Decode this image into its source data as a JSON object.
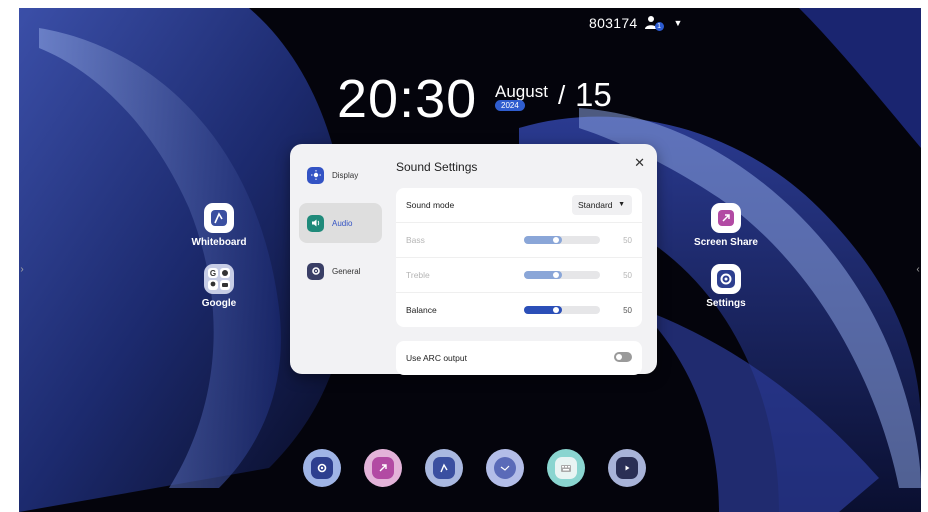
{
  "statusbar": {
    "user_id": "803174",
    "user_count": "1"
  },
  "clock": {
    "time": "20:30",
    "month": "August",
    "year": "2024",
    "separator": "/",
    "day": "15"
  },
  "desktop": {
    "left_apps": [
      {
        "label": "Whiteboard",
        "icon": "whiteboard-icon"
      },
      {
        "label": "Google",
        "icon": "google-apps-folder-icon"
      }
    ],
    "right_apps": [
      {
        "label": "Screen Share",
        "icon": "screen-share-icon"
      },
      {
        "label": "Settings",
        "icon": "settings-icon"
      }
    ]
  },
  "dialog": {
    "title": "Sound Settings",
    "nav": [
      {
        "label": "Display",
        "icon": "sun-icon",
        "color": "#3353c4"
      },
      {
        "label": "Audio",
        "icon": "speaker-icon",
        "color": "#1f8a7a"
      },
      {
        "label": "General",
        "icon": "gear-icon",
        "color": "#3a3f66"
      }
    ],
    "sound_mode": {
      "label": "Sound mode",
      "value": "Standard"
    },
    "bass": {
      "label": "Bass",
      "value": "50",
      "level": 0.5
    },
    "treble": {
      "label": "Treble",
      "value": "50",
      "level": 0.5
    },
    "balance": {
      "label": "Balance",
      "value": "50",
      "level": 0.5
    },
    "arc": {
      "label": "Use ARC output",
      "on": false
    }
  },
  "dock": [
    {
      "icon": "settings-icon",
      "ring": "#9fb4e6"
    },
    {
      "icon": "screen-share-icon",
      "ring": "#e3b3d9"
    },
    {
      "icon": "whiteboard-icon",
      "ring": "#a9b8e0"
    },
    {
      "icon": "clock-icon",
      "ring": "#b3bde8"
    },
    {
      "icon": "keyboard-icon",
      "ring": "#8ad5d0"
    },
    {
      "icon": "youtube-icon",
      "ring": "#a8b3d8"
    }
  ],
  "colors": {
    "accent": "#2b4fb8",
    "dialog_bg": "#f2f2f4"
  }
}
